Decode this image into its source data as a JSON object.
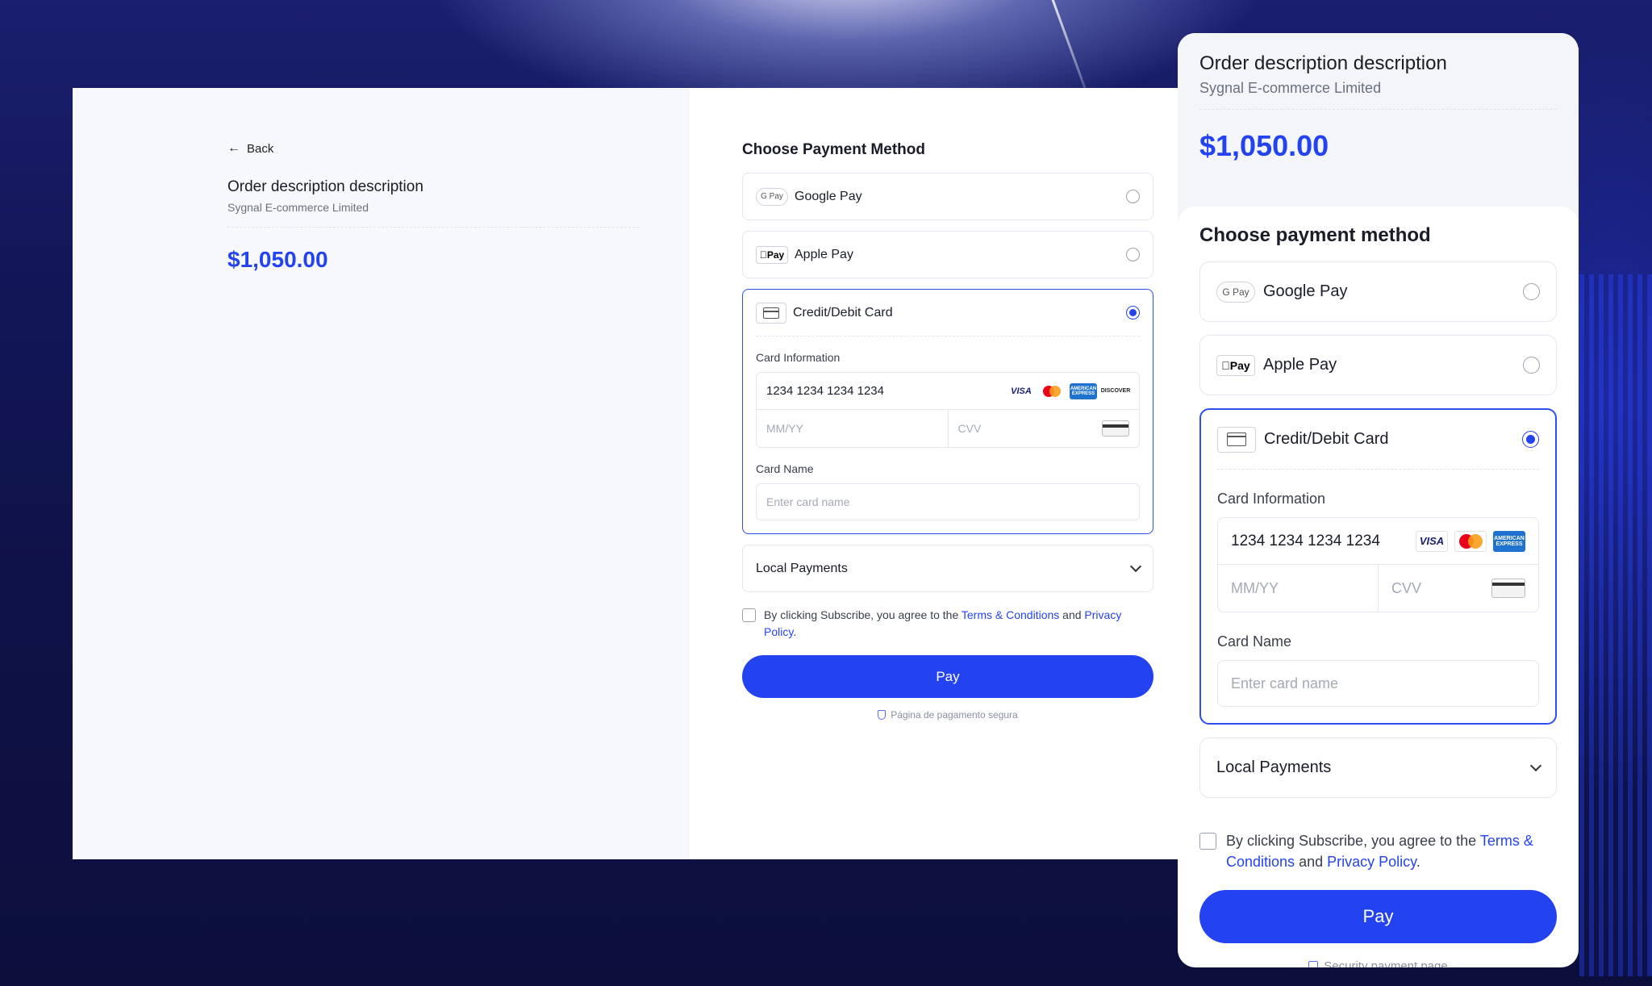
{
  "desktop": {
    "back_label": "Back",
    "order_title": "Order description description",
    "merchant": "Sygnal E-commerce Limited",
    "amount": "$1,050.00",
    "section_title": "Choose Payment Method",
    "methods": [
      {
        "label": "Google Pay",
        "logo": "G Pay"
      },
      {
        "label": "Apple Pay",
        "logo": "Pay"
      },
      {
        "label": "Credit/Debit Card"
      }
    ],
    "card_info_label": "Card Information",
    "card_number": "1234 1234 1234 1234",
    "expiry_placeholder": "MM/YY",
    "cvv_placeholder": "CVV",
    "card_name_label": "Card Name",
    "card_name_placeholder": "Enter card name",
    "local_payments": "Local Payments",
    "agree_prefix": "By clicking Subscribe, you agree to the ",
    "terms_link": "Terms & Conditions",
    "agree_and": " and ",
    "privacy_link": "Privacy Policy",
    "agree_suffix": ".",
    "pay_label": "Pay",
    "secure_text": "Página de pagamento segura"
  },
  "mobile": {
    "order_title": "Order description description",
    "merchant": "Sygnal E-commerce Limited",
    "amount": "$1,050.00",
    "section_title": "Choose payment method",
    "methods": [
      {
        "label": "Google Pay",
        "logo": "G Pay"
      },
      {
        "label": "Apple Pay",
        "logo": "Pay"
      },
      {
        "label": "Credit/Debit Card"
      }
    ],
    "card_info_label": "Card Information",
    "card_number": "1234 1234 1234 1234",
    "expiry_placeholder": "MM/YY",
    "cvv_placeholder": "CVV",
    "card_name_label": "Card Name",
    "card_name_placeholder": "Enter card name",
    "local_payments": "Local Payments",
    "agree_prefix": "By clicking Subscribe, you agree to the ",
    "terms_link": "Terms & Conditions",
    "agree_and": " and ",
    "privacy_link": "Privacy Policy",
    "agree_suffix": ".",
    "pay_label": "Pay",
    "secure_text": "Security payment page"
  },
  "brands": {
    "visa": "VISA",
    "amex": "AMERICAN EXPRESS",
    "discover": "DISCOVER"
  },
  "colors": {
    "accent": "#2443f0",
    "background": "#121657"
  },
  "icons": {
    "back": "arrow-left-icon",
    "card": "credit-card-icon",
    "chevron": "chevron-down-icon",
    "shield": "shield-icon"
  }
}
